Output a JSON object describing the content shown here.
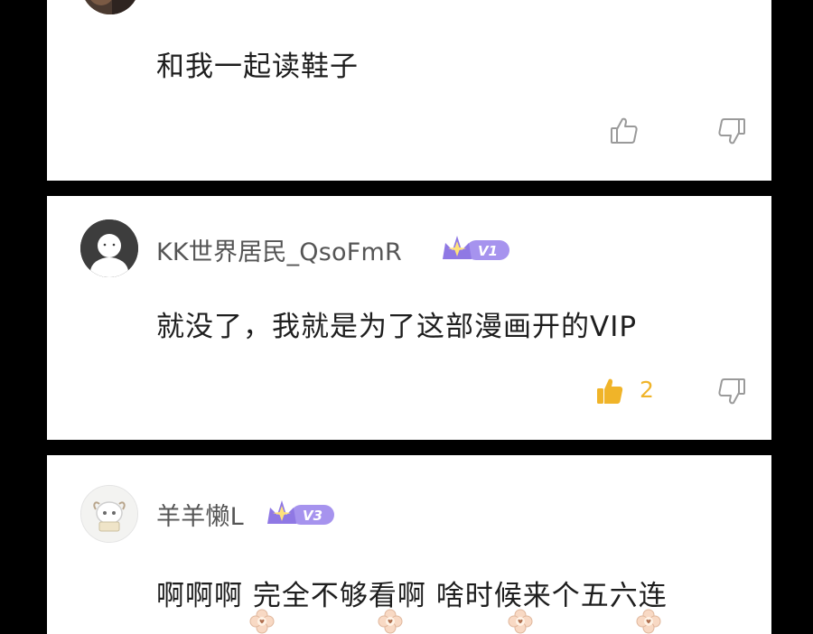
{
  "comments": [
    {
      "username": "",
      "text": "和我一起读鞋子",
      "likes": null
    },
    {
      "username": "KK世界居民_QsoFmR",
      "badge": "V1",
      "text": "就没了，我就是为了这部漫画开的VIP",
      "likes": "2",
      "liked": true
    },
    {
      "username": "羊羊懒L",
      "badge": "V3",
      "text": "啊啊啊 完全不够看啊 啥时候来个五六连"
    }
  ],
  "colors": {
    "background": "#000000",
    "card": "#ffffff",
    "username": "#555555",
    "comment_text": "#1e1e1e",
    "icon_gray": "#9a9a9a",
    "liked_yellow": "#f0b429",
    "badge_purple": "#9b86e8"
  },
  "icons": {
    "like": "thumbs-up-icon",
    "dislike": "thumbs-down-icon",
    "vip": "crown-vip-badge-icon",
    "reaction": "flower-emoji-icon"
  }
}
